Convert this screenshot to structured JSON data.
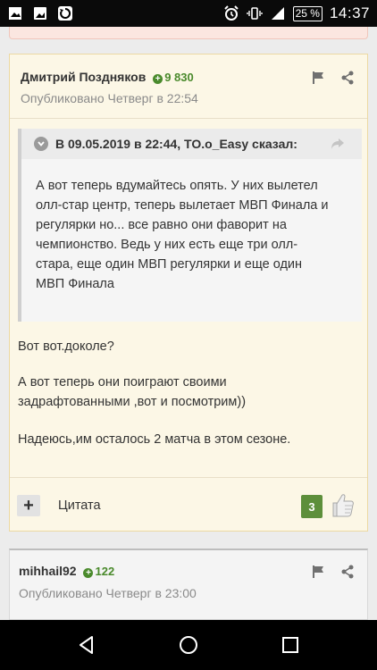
{
  "statusbar": {
    "left_icons": [
      "gallery-icon",
      "image-icon",
      "sync-icon"
    ],
    "right_icons": [
      "alarm-icon",
      "vibrate-icon",
      "signal-icon"
    ],
    "battery": "25 %",
    "time": "14:37"
  },
  "post": {
    "author": "Дмитрий Поздняков",
    "reputation": "9 830",
    "published": "Опубликовано Четверг в 22:54",
    "quote": {
      "header": "В 09.05.2019 в 22:44, TO.o_Easy сказал:",
      "lines": [
        "А вот теперь вдумайтесь опять. У них вылетел",
        "олл-стар центр, теперь вылетает МВП Финала и",
        "регулярки но... все равно они фаворит на",
        "чемпионство. Ведь у них есть еще три олл-",
        "стара, еще один МВП регулярки и еще один",
        "МВП Финала"
      ]
    },
    "paragraph1": "Вот вот.доколе?",
    "paragraph2_line1": "А вот теперь они поиграют своими",
    "paragraph2_line2": "задрафтованными ,вот и посмотрим))",
    "paragraph3": "Надеюсь,им осталось 2 матча в этом сезоне.",
    "footer": {
      "plus": "+",
      "quote_label": "Цитата",
      "likes": "3"
    }
  },
  "post2": {
    "author": "mihhail92",
    "reputation": "122",
    "published": "Опубликовано Четверг в 23:00"
  },
  "colors": {
    "post_bg": "#fcf7e6",
    "rep_green": "#4a8a2c",
    "likes_green": "#5d8f3b"
  }
}
